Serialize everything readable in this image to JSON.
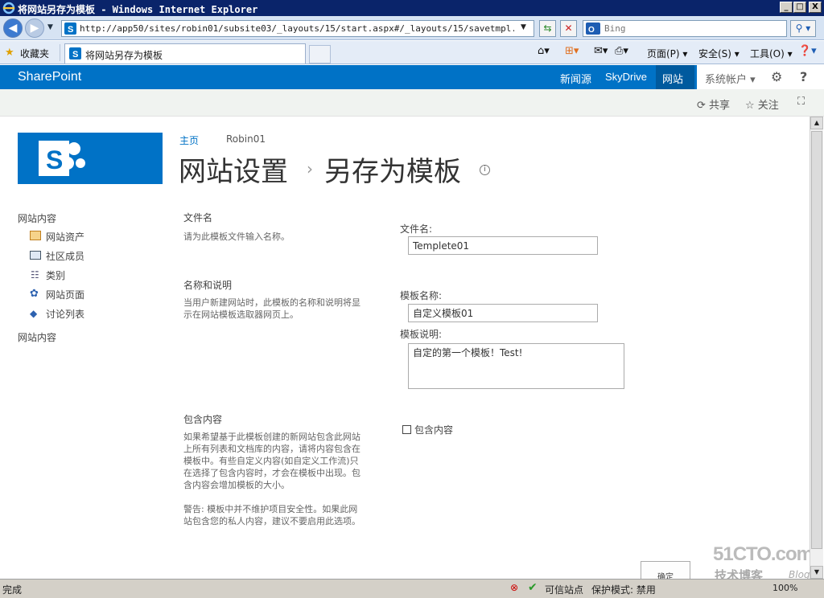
{
  "window": {
    "title": "将网站另存为模板 - Windows Internet Explorer",
    "min": "_",
    "max": "□",
    "close": "X"
  },
  "browser": {
    "address": "http://app50/sites/robin01/subsite03/_layouts/15/start.aspx#/_layouts/15/savetmpl.aspx",
    "search_placeholder": "Bing",
    "favorites_label": "收藏夹",
    "tab_title": "将网站另存为模板",
    "cmd_page": "页面(P)",
    "cmd_safety": "安全(S)",
    "cmd_tools": "工具(O)"
  },
  "sp": {
    "brand": "SharePoint",
    "nav": [
      "新闻源",
      "SkyDrive",
      "网站"
    ],
    "account": "系统帐户",
    "share": "共享",
    "follow": "关注"
  },
  "breadcrumb": {
    "home": "主页",
    "site": "Robin01"
  },
  "page": {
    "title_main": "网站设置",
    "separator": "›",
    "title_sub": "另存为模板"
  },
  "quicklaunch": {
    "header": "网站内容",
    "items": [
      "网站资产",
      "社区成员",
      "类别",
      "网站页面",
      "讨论列表"
    ],
    "footer": "网站内容"
  },
  "form": {
    "file_section_title": "文件名",
    "file_section_desc": "请为此模板文件输入名称。",
    "file_label": "文件名:",
    "file_value": "Templete01",
    "name_section_title": "名称和说明",
    "name_section_desc_1": "当用户新建网站时，此模板的名称和说明将显",
    "name_section_desc_2": "示在网站模板选取器网页上。",
    "tname_label": "模板名称:",
    "tname_value": "自定义模板01",
    "tdesc_label": "模板说明:",
    "tdesc_value": "自定的第一个模板！Test!",
    "content_section_title": "包含内容",
    "content_desc": [
      "如果希望基于此模板创建的新网站包含此网站",
      "上所有列表和文档库的内容，请将内容包含在",
      "模板中。有些自定义内容(如自定义工作流)只",
      "在选择了包含内容时，才会在模板中出现。包",
      "含内容会增加模板的大小。"
    ],
    "content_warn": [
      "警告: 模板中并不维护项目安全性。如果此网",
      "站包含您的私人内容，建议不要启用此选项。"
    ],
    "include_label": "包含内容",
    "include_checked": false,
    "ok_label": "确定"
  },
  "statusbar": {
    "done": "完成",
    "zone": "可信站点",
    "protected_mode": "保护模式: 禁用",
    "zoom": "100%"
  },
  "watermark": {
    "site": "51CTO.com",
    "blog": "技术博客",
    "blog_en": "Blog"
  }
}
